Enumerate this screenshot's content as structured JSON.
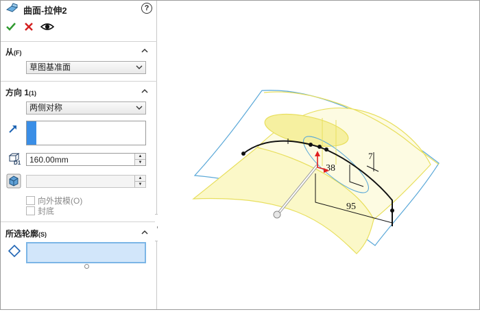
{
  "feature": {
    "title": "曲面-拉伸2",
    "help_label": "?"
  },
  "icons": [
    "extrude-surface-icon",
    "help-icon",
    "ok-check-icon",
    "cancel-x-icon",
    "preview-eye-icon",
    "direction-arrow-icon",
    "depth-icon",
    "draft-icon",
    "contour-icon"
  ],
  "from_section": {
    "label": "从",
    "shortcut": "(F)",
    "value": "草图基准面"
  },
  "direction_section": {
    "label": "方向 1",
    "shortcut": "(1)",
    "end_condition": "两侧对称",
    "depth_value": "160.00mm",
    "draft_value": "",
    "draft_outward_label": "向外拔模(O)",
    "cap_end_label": "封底"
  },
  "contours_section": {
    "label": "所选轮廓",
    "shortcut": "(S)"
  },
  "dimensions": {
    "d1": "38",
    "d2": "95",
    "d3": "7"
  },
  "colors": {
    "accent_blue": "#3a8ee6",
    "selection_fill": "#d2e6fa",
    "preview_yellow": "#f6f0a0",
    "edge_blue": "#5aa8d8"
  }
}
